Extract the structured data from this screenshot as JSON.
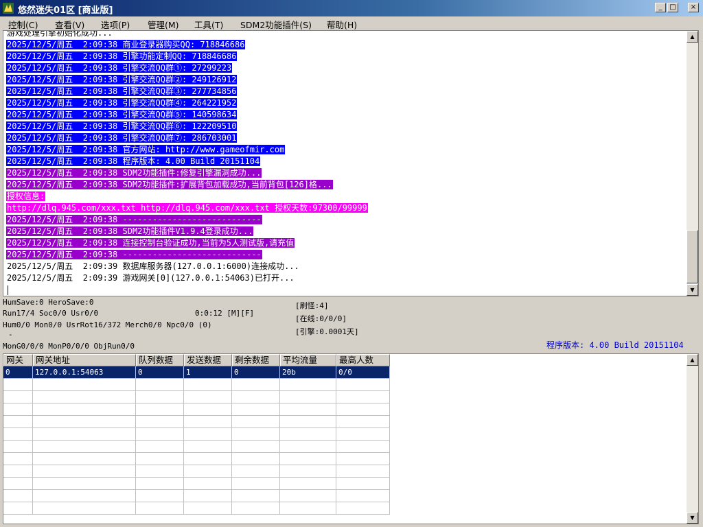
{
  "window": {
    "title": "悠然迷失01区 [商业版]",
    "minimize": "_",
    "maximize": "□",
    "close": "×"
  },
  "menu": [
    {
      "label": "控制(C)"
    },
    {
      "label": "查看(V)"
    },
    {
      "label": "选项(P)"
    },
    {
      "label": "管理(M)"
    },
    {
      "label": "工具(T)"
    },
    {
      "label": "SDM2功能插件(S)"
    },
    {
      "label": "帮助(H)"
    }
  ],
  "log": [
    {
      "text": "游戏处理引擎初始化成功...",
      "style": "plain"
    },
    {
      "text": "2025/12/5/周五  2:09:38 商业登录器购买QQ: 718846686",
      "style": "blue"
    },
    {
      "text": "2025/12/5/周五  2:09:38 引擎功能定制QQ: 718846686",
      "style": "blue"
    },
    {
      "text": "2025/12/5/周五  2:09:38 引擎交流QQ群①: 27299223",
      "style": "blue"
    },
    {
      "text": "2025/12/5/周五  2:09:38 引擎交流QQ群②: 249126912",
      "style": "blue"
    },
    {
      "text": "2025/12/5/周五  2:09:38 引擎交流QQ群③: 277734856",
      "style": "blue"
    },
    {
      "text": "2025/12/5/周五  2:09:38 引擎交流QQ群④: 264221952",
      "style": "blue"
    },
    {
      "text": "2025/12/5/周五  2:09:38 引擎交流QQ群⑤: 140598634",
      "style": "blue"
    },
    {
      "text": "2025/12/5/周五  2:09:38 引擎交流QQ群⑥: 122209510",
      "style": "blue"
    },
    {
      "text": "2025/12/5/周五  2:09:38 引擎交流QQ群⑦: 286703001",
      "style": "blue"
    },
    {
      "text": "2025/12/5/周五  2:09:38 官方网站: http://www.gameofmir.com",
      "style": "blue"
    },
    {
      "text": "2025/12/5/周五  2:09:38 程序版本: 4.00 Build 20151104",
      "style": "blue"
    },
    {
      "text": "2025/12/5/周五  2:09:38 SDM2功能插件:修复引擎漏洞成功...",
      "style": "purple"
    },
    {
      "text": "2025/12/5/周五  2:09:38 SDM2功能插件:扩展背包加载成功,当前背包[126]格...",
      "style": "purple"
    },
    {
      "text": "授权信息:",
      "style": "magenta"
    },
    {
      "text": "http://dlq.945.com/xxx.txt http://dlq.945.com/xxx.txt 授权天数:97300/99999",
      "style": "magenta"
    },
    {
      "text": "2025/12/5/周五  2:09:38 ----------------------------",
      "style": "purple"
    },
    {
      "text": "2025/12/5/周五  2:09:38 SDM2功能插件V1.9.4登录成功...",
      "style": "purple"
    },
    {
      "text": "2025/12/5/周五  2:09:38 连接控制台验证成功,当前为5人测试版,请充值",
      "style": "purple"
    },
    {
      "text": "2025/12/5/周五  2:09:38 ----------------------------",
      "style": "purple"
    },
    {
      "text": "2025/12/5/周五  2:09:39 数据库服务器(127.0.0.1:6000)连接成功...",
      "style": "plain"
    },
    {
      "text": "2025/12/5/周五  2:09:39 游戏网关[0](127.0.0.1:54063)已打开...",
      "style": "plain"
    }
  ],
  "status": {
    "humsave": "HumSave:0 HeroSave:0",
    "run": "Run17/4 Soc0/0 Usr0/0",
    "timer": "0:0:12 [M][F]",
    "hum": "Hum0/0 Mon0/0 UsrRot16/372 Merch0/0 Npc0/0 (0)",
    "dash": "-",
    "mong": "MonG0/0/0 MonP0/0/0 ObjRun0/0",
    "refresh_monsters": "[刷怪:4]",
    "online": "[在线:0/0/0]",
    "engine": "[引擎:0.0001天]",
    "build_version": "程序版本: 4.00 Build 20151104"
  },
  "gateway_table": {
    "columns": [
      "网关",
      "网关地址",
      "队列数据",
      "发送数据",
      "剩余数据",
      "平均流量",
      "最高人数"
    ],
    "rows": [
      [
        "0",
        "127.0.0.1:54063",
        "0",
        "1",
        "0",
        "20b",
        "0/0"
      ]
    ]
  },
  "scroll": {
    "up": "▲",
    "down": "▼"
  }
}
